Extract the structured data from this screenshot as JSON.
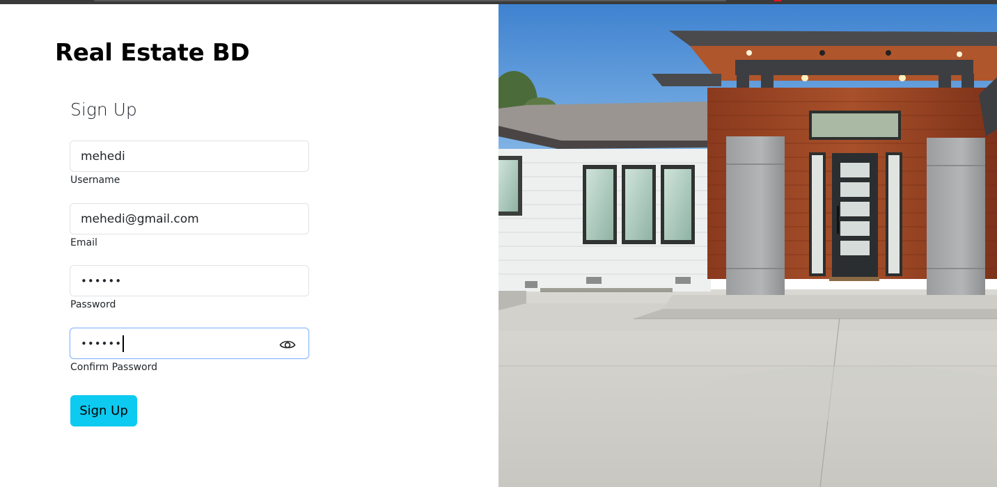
{
  "brand": {
    "title": "Real Estate BD"
  },
  "form": {
    "title": "Sign Up",
    "fields": {
      "username": {
        "value": "mehedi",
        "label": "Username"
      },
      "email": {
        "value": "mehedi@gmail.com",
        "label": "Email"
      },
      "password": {
        "value": "••••••",
        "label": "Password"
      },
      "confirm_password": {
        "value": "••••••",
        "label": "Confirm Password"
      }
    },
    "submit_label": "Sign Up"
  },
  "colors": {
    "accent": "#0dcaf0",
    "focus_border": "#86b7fe",
    "input_border": "#dee2e6",
    "text": "#212529"
  },
  "icons": {
    "show_password": "eye-icon"
  },
  "hero_image": {
    "subject": "modern-house-exterior"
  }
}
